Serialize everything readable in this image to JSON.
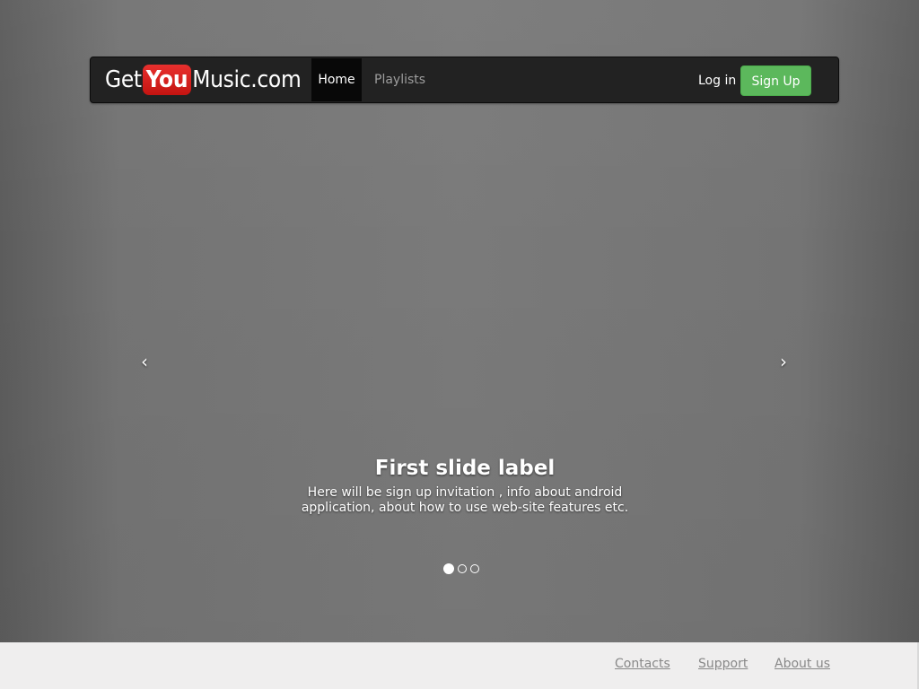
{
  "brand": {
    "get": "Get",
    "you": "You",
    "rest": "Music.com"
  },
  "nav": {
    "home": "Home",
    "playlists": "Playlists",
    "login": "Log in",
    "signup": "Sign Up"
  },
  "carousel": {
    "prev_icon": "‹",
    "next_icon": "›",
    "caption_title": "First slide label",
    "caption_text": "Here will be sign up invitation , info about android application, about how to use web-site features etc.",
    "slide_count": 3,
    "active_slide": 1
  },
  "footer": {
    "contacts": "Contacts",
    "support": "Support",
    "about": "About us"
  },
  "colors": {
    "navbar": "#222222",
    "signup": "#5cb85c",
    "brand_you": "#d41f1c",
    "footer": "#efeeee"
  }
}
